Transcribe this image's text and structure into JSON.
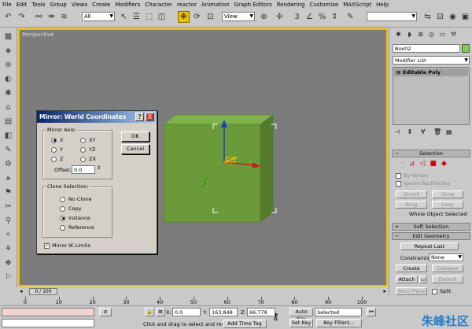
{
  "menu": [
    "File",
    "Edit",
    "Tools",
    "Group",
    "Views",
    "Create",
    "Modifiers",
    "Character",
    "reactor",
    "Animation",
    "Graph Editors",
    "Rendering",
    "Customize",
    "MAXScript",
    "Help"
  ],
  "toolbar": {
    "filter_value": "All",
    "view_value": "View"
  },
  "viewport": {
    "label": "Perspective",
    "object_color": "#6a9a3a"
  },
  "dialog": {
    "title": "Mirror: World Coordinates",
    "help_btn": "?",
    "close_btn": "X",
    "axis_group": "Mirror Axis:",
    "axes": [
      {
        "label": "X",
        "checked": true
      },
      {
        "label": "Y",
        "checked": false
      },
      {
        "label": "Z",
        "checked": false
      },
      {
        "label": "XY",
        "checked": false
      },
      {
        "label": "YZ",
        "checked": false
      },
      {
        "label": "ZX",
        "checked": false
      }
    ],
    "offset_label": "Offset:",
    "offset_value": "0.0",
    "clone_group": "Clone Selection:",
    "clone_options": [
      {
        "label": "No Clone",
        "checked": false
      },
      {
        "label": "Copy",
        "checked": false
      },
      {
        "label": "Instance",
        "checked": true
      },
      {
        "label": "Reference",
        "checked": false
      }
    ],
    "mirror_ik": "Mirror IK Limits",
    "mirror_ik_checked": true,
    "ok": "OK",
    "cancel": "Cancel"
  },
  "panel": {
    "object_name": "Box02",
    "object_color": "#7ccf4a",
    "modifier_list": "Modifier List",
    "stack_item": "Editable Poly",
    "selection_title": "Selection",
    "by_vertex": "By Vertex",
    "ignore_backfacing": "Ignore Backfacing",
    "shrink": "Shrink",
    "grow": "Grow",
    "ring": "Ring",
    "loop": "Loop",
    "selection_status": "Whole Object Selected",
    "soft_selection_title": "Soft Selection",
    "edit_geometry_title": "Edit Geometry",
    "repeat_last": "Repeat Last",
    "constraints_label": "Constraints:",
    "constraints_value": "None",
    "create": "Create",
    "collapse": "Collapse",
    "attach": "Attach",
    "detach": "Detach",
    "slice_plane": "Slice Plane",
    "split": "Split"
  },
  "timeline": {
    "frame_display": "0 / 100",
    "ticks": [
      "0",
      "10",
      "20",
      "30",
      "40",
      "50",
      "60",
      "70",
      "80",
      "90",
      "100"
    ]
  },
  "status": {
    "x_label": "X:",
    "x_value": "0,0",
    "y_label": "Y:",
    "y_value": "163,848",
    "z_label": "Z:",
    "z_value": "66,778",
    "prompt": "Click and drag to select and move",
    "add_time_tag": "Add Time Tag",
    "auto_key": "Auto Key",
    "selected": "Selected",
    "set_key": "Set Key",
    "key_filters": "Key Filters..."
  },
  "watermark": "朱峰社区"
}
